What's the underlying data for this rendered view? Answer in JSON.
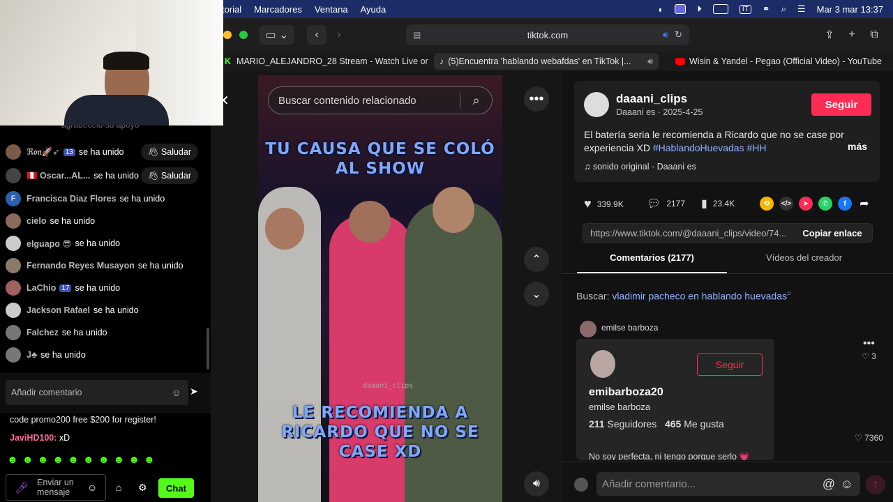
{
  "menubar": {
    "items": [
      "torial",
      "Marcadores",
      "Ventana",
      "Ayuda"
    ],
    "datetime": "Mar 3 mar 13:37",
    "input": "IT"
  },
  "browser": {
    "url": "tiktok.com",
    "tabs": [
      {
        "label": "MARIO_ALEJANDRO_28 Stream - Watch Live on..."
      },
      {
        "label": "(5)Encuentra 'hablando webafdas' en TikTok |..."
      },
      {
        "label": "Wisin & Yandel - Pegao (Official Video) - YouTube"
      }
    ]
  },
  "video": {
    "search_placeholder": "Buscar contenido relacionado",
    "text_top": "TU CAUSA QUE SE COLÓ AL SHOW",
    "text_bottom": "LE RECOMIENDA A RICARDO QUE NO SE CASE XD",
    "watermark": "daaani_clips"
  },
  "post": {
    "username": "daaani_clips",
    "subtitle": "Daaani es · 2025-4-25",
    "follow": "Seguir",
    "description": "El batería seria le recomienda a Ricardo que no se case por experiencia XD",
    "hashtags": "#HablandoHuevadas #HH",
    "more": "más",
    "sound": "sonido original - Daaani es",
    "likes": "339.9K",
    "comments": "2177",
    "saves": "23.4K",
    "link": "https://www.tiktok.com/@daaani_clips/video/74...",
    "copy": "Copiar enlace"
  },
  "tabs": {
    "comments": "Comentarios (2177)",
    "creator": "Vídeos del creador"
  },
  "search_hint": {
    "label": "Buscar:",
    "query": "vladimir pacheco en hablando huevadas"
  },
  "comment": {
    "author": "emilse barboza",
    "likes": "3",
    "likes2": "7360"
  },
  "popup": {
    "handle": "emibarboza20",
    "name": "emilse barboza",
    "followers_n": "211",
    "followers_l": "Seguidores",
    "likes_n": "465",
    "likes_l": "Me gusta",
    "bio": "No soy perfecta, ni tengo porque serlo 💗",
    "follow": "Seguir"
  },
  "comment_input": "Añadir comentario...",
  "stream": {
    "top_text": "agradecelo su apoyo",
    "joined": "se ha unido",
    "greet": "Saludar",
    "users": [
      {
        "name": "ℜ𝔬𝔫🚀➶",
        "badge": "13",
        "greet": true,
        "color": "#7a5b4a"
      },
      {
        "name": "🇵🇪 Oscar...AL...",
        "greet": true,
        "color": "#444"
      },
      {
        "name": "Francisca Diaz Flores",
        "initial": "F",
        "color": "#2b5fb0"
      },
      {
        "name": "cielo",
        "color": "#8a6a5a"
      },
      {
        "name": "elguapo 😎",
        "color": "#ccc"
      },
      {
        "name": "Fernando Reyes Musayon",
        "color": "#8a7a6a"
      },
      {
        "name": "LaChio",
        "badge": "17",
        "color": "#a06060"
      },
      {
        "name": "Jackson Rafael",
        "color": "#ccc"
      },
      {
        "name": "Falchez",
        "color": "#777"
      },
      {
        "name": "J♣",
        "color": "#777"
      }
    ],
    "comment_placeholder": "Añadir comentario",
    "promo": "code promo200 free $200 for register!",
    "msg_user": "JaviHD100:",
    "msg_text": "xD",
    "send_placeholder": "Enviar un mensaje",
    "chat_btn": "Chat"
  }
}
